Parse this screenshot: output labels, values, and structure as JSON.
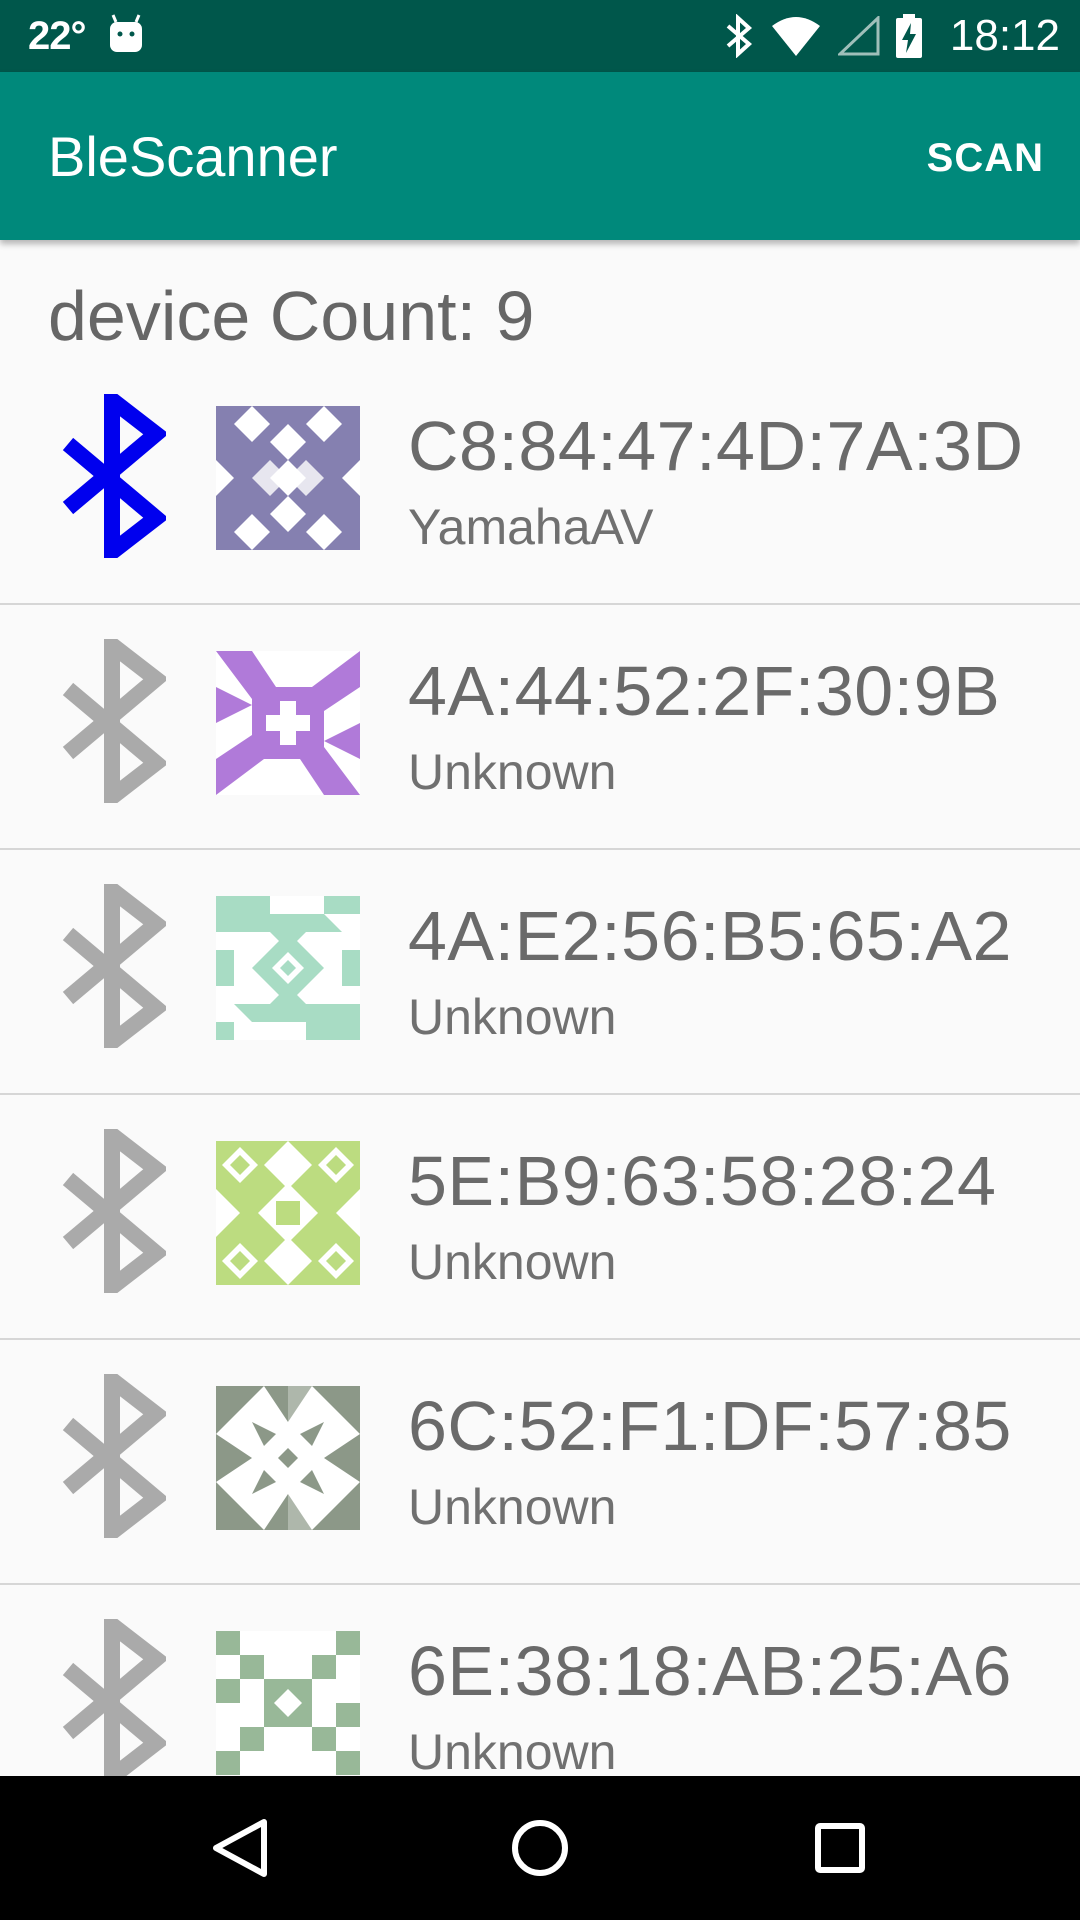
{
  "status_bar": {
    "temperature": "22°",
    "time": "18:12",
    "icons": [
      "android-icon",
      "bluetooth-icon",
      "wifi-icon",
      "signal-icon",
      "battery-charging-icon"
    ]
  },
  "app_bar": {
    "title": "BleScanner",
    "scan_label": "SCAN"
  },
  "device_count_label": "device Count: 9",
  "colors": {
    "status_bar": "#00574b",
    "app_bar": "#00897b",
    "bt_active": "#0000ee",
    "bt_inactive": "#aaaaaa"
  },
  "devices": [
    {
      "mac": "C8:84:47:4D:7A:3D",
      "name": "YamahaAV",
      "active": true,
      "avatar_color": "#8580b0"
    },
    {
      "mac": "4A:44:52:2F:30:9B",
      "name": "Unknown",
      "active": false,
      "avatar_color": "#b07ad9"
    },
    {
      "mac": "4A:E2:56:B5:65:A2",
      "name": "Unknown",
      "active": false,
      "avatar_color": "#a8dcc4"
    },
    {
      "mac": "5E:B9:63:58:28:24",
      "name": "Unknown",
      "active": false,
      "avatar_color": "#bcdc80"
    },
    {
      "mac": "6C:52:F1:DF:57:85",
      "name": "Unknown",
      "active": false,
      "avatar_color": "#8c9888"
    },
    {
      "mac": "6E:38:18:AB:25:A6",
      "name": "Unknown",
      "active": false,
      "avatar_color": "#98b898"
    }
  ],
  "nav_bar": {
    "icons": [
      "back-icon",
      "home-icon",
      "recents-icon"
    ]
  }
}
